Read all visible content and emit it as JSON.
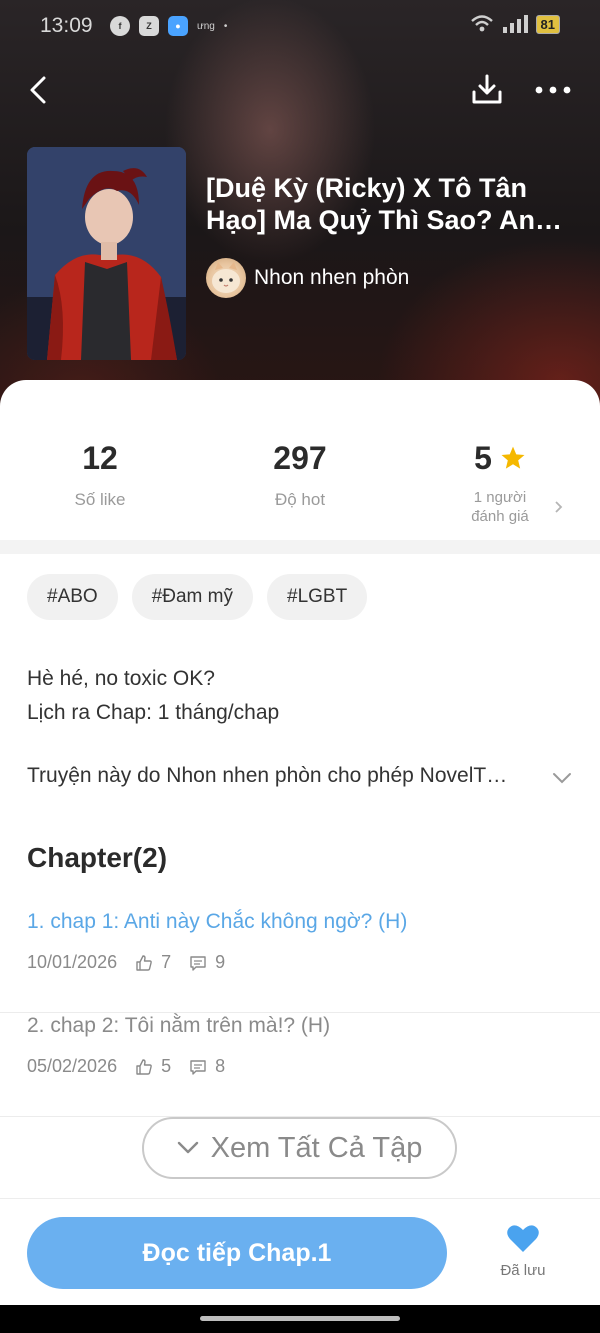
{
  "status_bar": {
    "time": "13:09",
    "app_label": "ưng",
    "battery": "81"
  },
  "novel": {
    "title": "[Duệ Kỳ (Ricky) X Tô Tân Hạo] Ma Quỷ Thì Sao? An…",
    "author": "Nhon nhen phòn"
  },
  "stats": {
    "likes": {
      "value": "12",
      "label": "Số like"
    },
    "hot": {
      "value": "297",
      "label": "Độ hot"
    },
    "rating": {
      "value": "5",
      "label_line1": "1 người",
      "label_line2": "đánh giá"
    }
  },
  "tags": [
    "#ABO",
    "#Đam mỹ",
    "#LGBT"
  ],
  "description": {
    "line1": "Hè hé, no toxic OK?",
    "line2": "Lịch ra Chap: 1 tháng/chap",
    "permission": "Truyện này do Nhon nhen phòn cho phép NovelT…"
  },
  "chapters": {
    "heading": "Chapter(2)",
    "items": [
      {
        "title": "1. chap 1: Anti này Chắc không ngờ? (H)",
        "date": "10/01/2026",
        "likes": "7",
        "comments": "9"
      },
      {
        "title": "2. chap 2: Tôi nằm trên mà!? (H)",
        "date": "05/02/2026",
        "likes": "5",
        "comments": "8"
      }
    ],
    "see_all": "Xem Tất Cả Tập"
  },
  "bottom": {
    "read_button": "Đọc tiếp Chap.1",
    "saved_label": "Đã lưu"
  },
  "colors": {
    "accent": "#6ab0f0",
    "link": "#5aa7e6",
    "star": "#f5b800",
    "heart": "#4aa3ef"
  }
}
